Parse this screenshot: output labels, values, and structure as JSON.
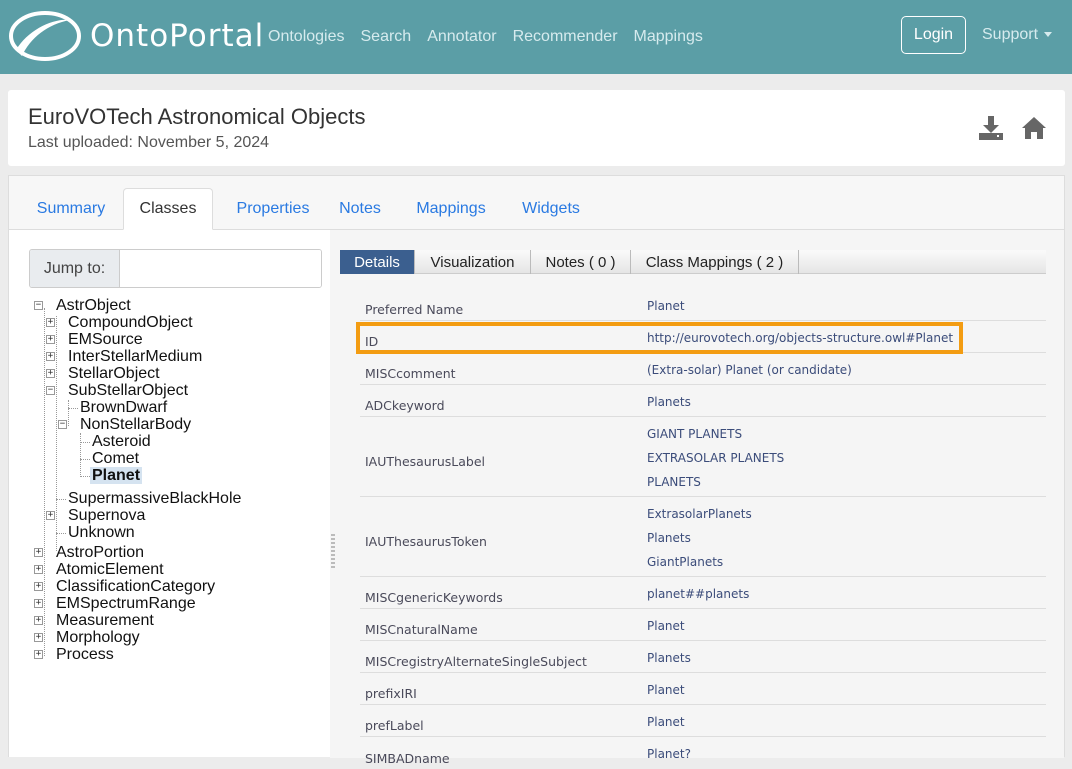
{
  "navbar": {
    "brand": "OntoPortal",
    "links": [
      "Ontologies",
      "Search",
      "Annotator",
      "Recommender",
      "Mappings"
    ],
    "login": "Login",
    "support": "Support"
  },
  "header": {
    "title": "EuroVOTech Astronomical Objects",
    "subtitle": "Last uploaded: November 5, 2024"
  },
  "tabs": [
    "Summary",
    "Classes",
    "Properties",
    "Notes",
    "Mappings",
    "Widgets"
  ],
  "active_tab": "Classes",
  "jump": {
    "label": "Jump to:",
    "value": ""
  },
  "tree": [
    {
      "label": "AstrObject",
      "toggle": "-"
    },
    {
      "label": "CompoundObject",
      "toggle": "+"
    },
    {
      "label": "EMSource",
      "toggle": "+"
    },
    {
      "label": "InterStellarMedium",
      "toggle": "+"
    },
    {
      "label": "StellarObject",
      "toggle": "+"
    },
    {
      "label": "SubStellarObject",
      "toggle": "-"
    },
    {
      "label": "BrownDwarf",
      "toggle": ""
    },
    {
      "label": "NonStellarBody",
      "toggle": "-"
    },
    {
      "label": "Asteroid",
      "toggle": ""
    },
    {
      "label": "Comet",
      "toggle": ""
    },
    {
      "label": "Planet",
      "toggle": "",
      "selected": true
    },
    {
      "label": "SupermassiveBlackHole",
      "toggle": ""
    },
    {
      "label": "Supernova",
      "toggle": "+"
    },
    {
      "label": "Unknown",
      "toggle": ""
    },
    {
      "label": "AstroPortion",
      "toggle": "+"
    },
    {
      "label": "AtomicElement",
      "toggle": "+"
    },
    {
      "label": "ClassificationCategory",
      "toggle": "+"
    },
    {
      "label": "EMSpectrumRange",
      "toggle": "+"
    },
    {
      "label": "Measurement",
      "toggle": "+"
    },
    {
      "label": "Morphology",
      "toggle": "+"
    },
    {
      "label": "Process",
      "toggle": "+"
    }
  ],
  "detail_tabs": [
    "Details",
    "Visualization",
    "Notes ( 0 )",
    "Class Mappings ( 2 )"
  ],
  "details": [
    {
      "key": "Preferred Name",
      "values": [
        "Planet"
      ]
    },
    {
      "key": "ID",
      "values": [
        "http://eurovotech.org/objects-structure.owl#Planet"
      ]
    },
    {
      "key": "MISCcomment",
      "values": [
        "(Extra-solar) Planet (or candidate)"
      ]
    },
    {
      "key": "ADCkeyword",
      "values": [
        "Planets"
      ]
    },
    {
      "key": "IAUThesaurusLabel",
      "values": [
        "GIANT PLANETS",
        "EXTRASOLAR PLANETS",
        "PLANETS"
      ]
    },
    {
      "key": "IAUThesaurusToken",
      "values": [
        "ExtrasolarPlanets",
        "Planets",
        "GiantPlanets"
      ]
    },
    {
      "key": "MISCgenericKeywords",
      "values": [
        "planet##planets"
      ]
    },
    {
      "key": "MISCnaturalName",
      "values": [
        "Planet"
      ]
    },
    {
      "key": "MISCregistryAlternateSingleSubject",
      "values": [
        "Planets"
      ]
    },
    {
      "key": "prefixIRI",
      "values": [
        "Planet"
      ]
    },
    {
      "key": "prefLabel",
      "values": [
        "Planet"
      ]
    },
    {
      "key": "SIMBADname",
      "values": [
        "Planet?"
      ]
    }
  ],
  "colors": {
    "navbar": "#5b9ea6",
    "link": "#2a7ae2",
    "active_detail_tab": "#3b5f8f",
    "highlight": "#f39c12"
  }
}
